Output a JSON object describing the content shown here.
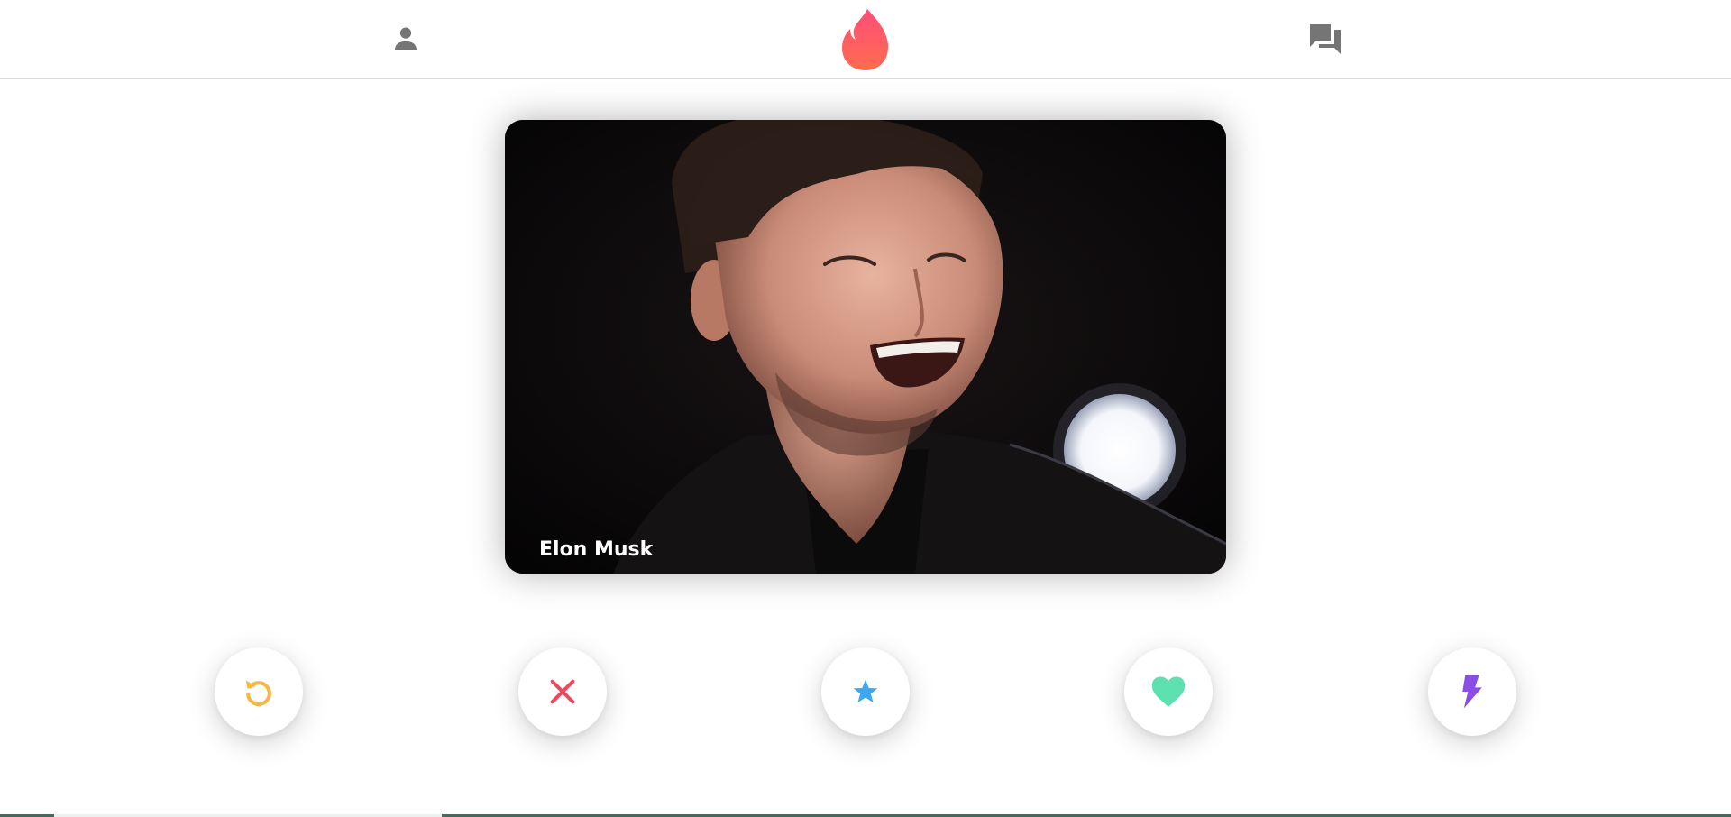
{
  "header": {
    "profile_icon": "person-icon",
    "logo_icon": "flame-icon",
    "messages_icon": "chat-bubbles-icon"
  },
  "card": {
    "name": "Elon Musk"
  },
  "actions": [
    {
      "id": "rewind",
      "icon": "rewind-icon",
      "color": "#f5b748"
    },
    {
      "id": "nope",
      "icon": "close-icon",
      "color": "#f0475e"
    },
    {
      "id": "super_like",
      "icon": "star-icon",
      "color": "#3fa7ef"
    },
    {
      "id": "like",
      "icon": "heart-icon",
      "color": "#5ee1b0"
    },
    {
      "id": "boost",
      "icon": "lightning-icon",
      "color": "#8a4ee6"
    }
  ],
  "colors": {
    "header_icon": "#757575",
    "logo_gradient_top": "#fd5068",
    "logo_gradient_bottom": "#ff7854",
    "card_name_text": "#ffffff"
  }
}
